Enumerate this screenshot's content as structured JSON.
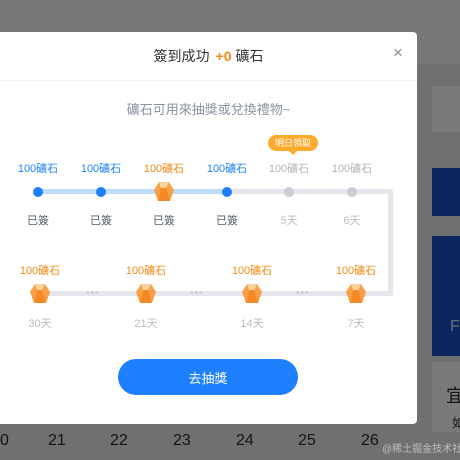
{
  "modal": {
    "title_prefix": "簽到成功",
    "plus": "+0",
    "title_suffix": "礦石",
    "close": "×",
    "subtitle": "礦石可用來抽獎或兌換禮物~",
    "cta": "去抽獎",
    "badge": "明日領取"
  },
  "days_row1": [
    {
      "amount": "100礦石",
      "label": "已簽"
    },
    {
      "amount": "100礦石",
      "label": "已簽"
    },
    {
      "amount": "100礦石",
      "label": "已簽"
    },
    {
      "amount": "100礦石",
      "label": "已簽"
    },
    {
      "amount": "100礦石",
      "label": "5天"
    },
    {
      "amount": "100礦石",
      "label": "6天"
    }
  ],
  "days_row2": [
    {
      "amount": "100礦石",
      "label": "30天"
    },
    {
      "amount": "100礦石",
      "label": "21天"
    },
    {
      "amount": "100礦石",
      "label": "14天"
    },
    {
      "amount": "100礦石",
      "label": "7天"
    }
  ],
  "background": {
    "calendar_numbers": [
      "0",
      "21",
      "22",
      "23",
      "24",
      "25",
      "26"
    ],
    "side_letter_1": "F",
    "side_letter_2": "宜",
    "side_letter_3": "如"
  },
  "watermark": "@稀土掘金技术社区",
  "colors": {
    "accent_blue": "#1e80ff",
    "accent_orange": "#f38a12",
    "badge_orange": "#ffaa2c"
  }
}
